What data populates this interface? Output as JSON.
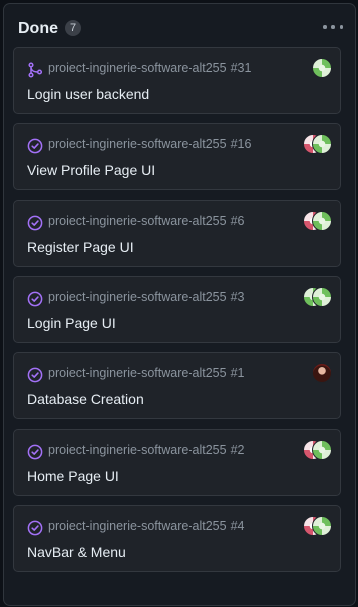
{
  "column": {
    "title": "Done",
    "count": "7"
  },
  "colors": {
    "done_purple": "#a371f7",
    "merged_purple": "#a371f7"
  },
  "cards": [
    {
      "repo": "proiect-inginerie-software-alt255",
      "number": "#31",
      "title": "Login user backend",
      "status_icon": "merged-pr-icon",
      "avatars": [
        "green-identicon"
      ]
    },
    {
      "repo": "proiect-inginerie-software-alt255",
      "number": "#16",
      "title": "View Profile Page UI",
      "status_icon": "completed-issue-icon",
      "avatars": [
        "pink-identicon",
        "green-identicon"
      ]
    },
    {
      "repo": "proiect-inginerie-software-alt255",
      "number": "#6",
      "title": "Register Page UI",
      "status_icon": "completed-issue-icon",
      "avatars": [
        "pink-identicon",
        "green-identicon"
      ]
    },
    {
      "repo": "proiect-inginerie-software-alt255",
      "number": "#3",
      "title": "Login Page UI",
      "status_icon": "completed-issue-icon",
      "avatars": [
        "green-identicon",
        "green-identicon"
      ]
    },
    {
      "repo": "proiect-inginerie-software-alt255",
      "number": "#1",
      "title": "Database Creation",
      "status_icon": "completed-issue-icon",
      "avatars": [
        "photo-avatar"
      ]
    },
    {
      "repo": "proiect-inginerie-software-alt255",
      "number": "#2",
      "title": "Home Page UI",
      "status_icon": "completed-issue-icon",
      "avatars": [
        "pink-identicon",
        "green-identicon"
      ]
    },
    {
      "repo": "proiect-inginerie-software-alt255",
      "number": "#4",
      "title": "NavBar & Menu",
      "status_icon": "completed-issue-icon",
      "avatars": [
        "pink-identicon",
        "green-identicon"
      ]
    }
  ]
}
